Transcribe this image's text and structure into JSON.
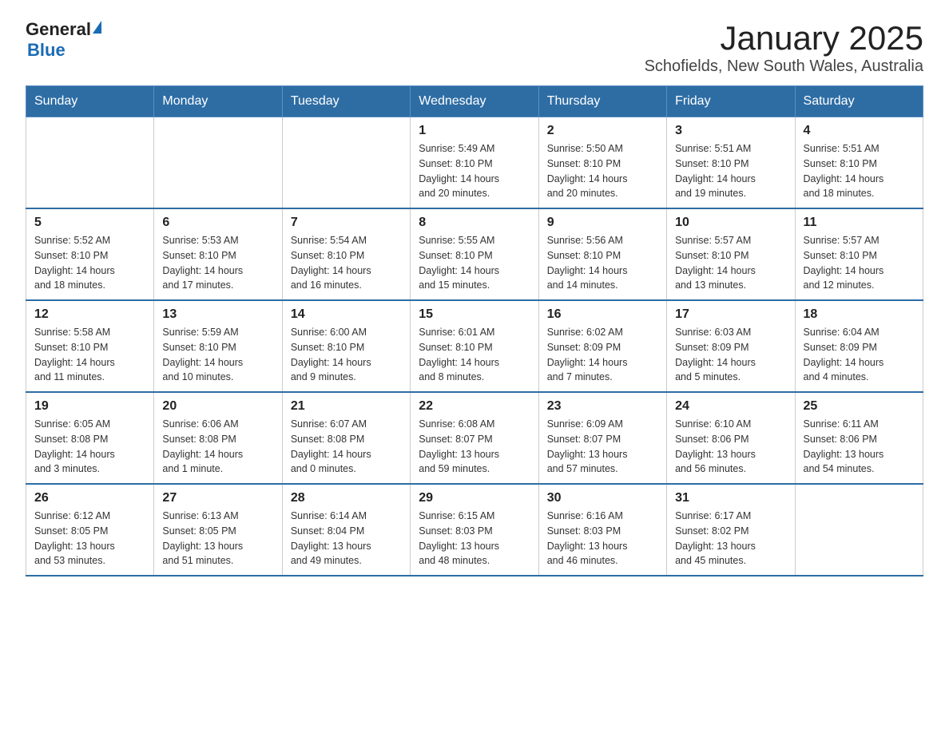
{
  "logo": {
    "general": "General",
    "blue": "Blue"
  },
  "title": "January 2025",
  "subtitle": "Schofields, New South Wales, Australia",
  "days_of_week": [
    "Sunday",
    "Monday",
    "Tuesday",
    "Wednesday",
    "Thursday",
    "Friday",
    "Saturday"
  ],
  "weeks": [
    [
      {
        "day": "",
        "info": ""
      },
      {
        "day": "",
        "info": ""
      },
      {
        "day": "",
        "info": ""
      },
      {
        "day": "1",
        "info": "Sunrise: 5:49 AM\nSunset: 8:10 PM\nDaylight: 14 hours\nand 20 minutes."
      },
      {
        "day": "2",
        "info": "Sunrise: 5:50 AM\nSunset: 8:10 PM\nDaylight: 14 hours\nand 20 minutes."
      },
      {
        "day": "3",
        "info": "Sunrise: 5:51 AM\nSunset: 8:10 PM\nDaylight: 14 hours\nand 19 minutes."
      },
      {
        "day": "4",
        "info": "Sunrise: 5:51 AM\nSunset: 8:10 PM\nDaylight: 14 hours\nand 18 minutes."
      }
    ],
    [
      {
        "day": "5",
        "info": "Sunrise: 5:52 AM\nSunset: 8:10 PM\nDaylight: 14 hours\nand 18 minutes."
      },
      {
        "day": "6",
        "info": "Sunrise: 5:53 AM\nSunset: 8:10 PM\nDaylight: 14 hours\nand 17 minutes."
      },
      {
        "day": "7",
        "info": "Sunrise: 5:54 AM\nSunset: 8:10 PM\nDaylight: 14 hours\nand 16 minutes."
      },
      {
        "day": "8",
        "info": "Sunrise: 5:55 AM\nSunset: 8:10 PM\nDaylight: 14 hours\nand 15 minutes."
      },
      {
        "day": "9",
        "info": "Sunrise: 5:56 AM\nSunset: 8:10 PM\nDaylight: 14 hours\nand 14 minutes."
      },
      {
        "day": "10",
        "info": "Sunrise: 5:57 AM\nSunset: 8:10 PM\nDaylight: 14 hours\nand 13 minutes."
      },
      {
        "day": "11",
        "info": "Sunrise: 5:57 AM\nSunset: 8:10 PM\nDaylight: 14 hours\nand 12 minutes."
      }
    ],
    [
      {
        "day": "12",
        "info": "Sunrise: 5:58 AM\nSunset: 8:10 PM\nDaylight: 14 hours\nand 11 minutes."
      },
      {
        "day": "13",
        "info": "Sunrise: 5:59 AM\nSunset: 8:10 PM\nDaylight: 14 hours\nand 10 minutes."
      },
      {
        "day": "14",
        "info": "Sunrise: 6:00 AM\nSunset: 8:10 PM\nDaylight: 14 hours\nand 9 minutes."
      },
      {
        "day": "15",
        "info": "Sunrise: 6:01 AM\nSunset: 8:10 PM\nDaylight: 14 hours\nand 8 minutes."
      },
      {
        "day": "16",
        "info": "Sunrise: 6:02 AM\nSunset: 8:09 PM\nDaylight: 14 hours\nand 7 minutes."
      },
      {
        "day": "17",
        "info": "Sunrise: 6:03 AM\nSunset: 8:09 PM\nDaylight: 14 hours\nand 5 minutes."
      },
      {
        "day": "18",
        "info": "Sunrise: 6:04 AM\nSunset: 8:09 PM\nDaylight: 14 hours\nand 4 minutes."
      }
    ],
    [
      {
        "day": "19",
        "info": "Sunrise: 6:05 AM\nSunset: 8:08 PM\nDaylight: 14 hours\nand 3 minutes."
      },
      {
        "day": "20",
        "info": "Sunrise: 6:06 AM\nSunset: 8:08 PM\nDaylight: 14 hours\nand 1 minute."
      },
      {
        "day": "21",
        "info": "Sunrise: 6:07 AM\nSunset: 8:08 PM\nDaylight: 14 hours\nand 0 minutes."
      },
      {
        "day": "22",
        "info": "Sunrise: 6:08 AM\nSunset: 8:07 PM\nDaylight: 13 hours\nand 59 minutes."
      },
      {
        "day": "23",
        "info": "Sunrise: 6:09 AM\nSunset: 8:07 PM\nDaylight: 13 hours\nand 57 minutes."
      },
      {
        "day": "24",
        "info": "Sunrise: 6:10 AM\nSunset: 8:06 PM\nDaylight: 13 hours\nand 56 minutes."
      },
      {
        "day": "25",
        "info": "Sunrise: 6:11 AM\nSunset: 8:06 PM\nDaylight: 13 hours\nand 54 minutes."
      }
    ],
    [
      {
        "day": "26",
        "info": "Sunrise: 6:12 AM\nSunset: 8:05 PM\nDaylight: 13 hours\nand 53 minutes."
      },
      {
        "day": "27",
        "info": "Sunrise: 6:13 AM\nSunset: 8:05 PM\nDaylight: 13 hours\nand 51 minutes."
      },
      {
        "day": "28",
        "info": "Sunrise: 6:14 AM\nSunset: 8:04 PM\nDaylight: 13 hours\nand 49 minutes."
      },
      {
        "day": "29",
        "info": "Sunrise: 6:15 AM\nSunset: 8:03 PM\nDaylight: 13 hours\nand 48 minutes."
      },
      {
        "day": "30",
        "info": "Sunrise: 6:16 AM\nSunset: 8:03 PM\nDaylight: 13 hours\nand 46 minutes."
      },
      {
        "day": "31",
        "info": "Sunrise: 6:17 AM\nSunset: 8:02 PM\nDaylight: 13 hours\nand 45 minutes."
      },
      {
        "day": "",
        "info": ""
      }
    ]
  ]
}
